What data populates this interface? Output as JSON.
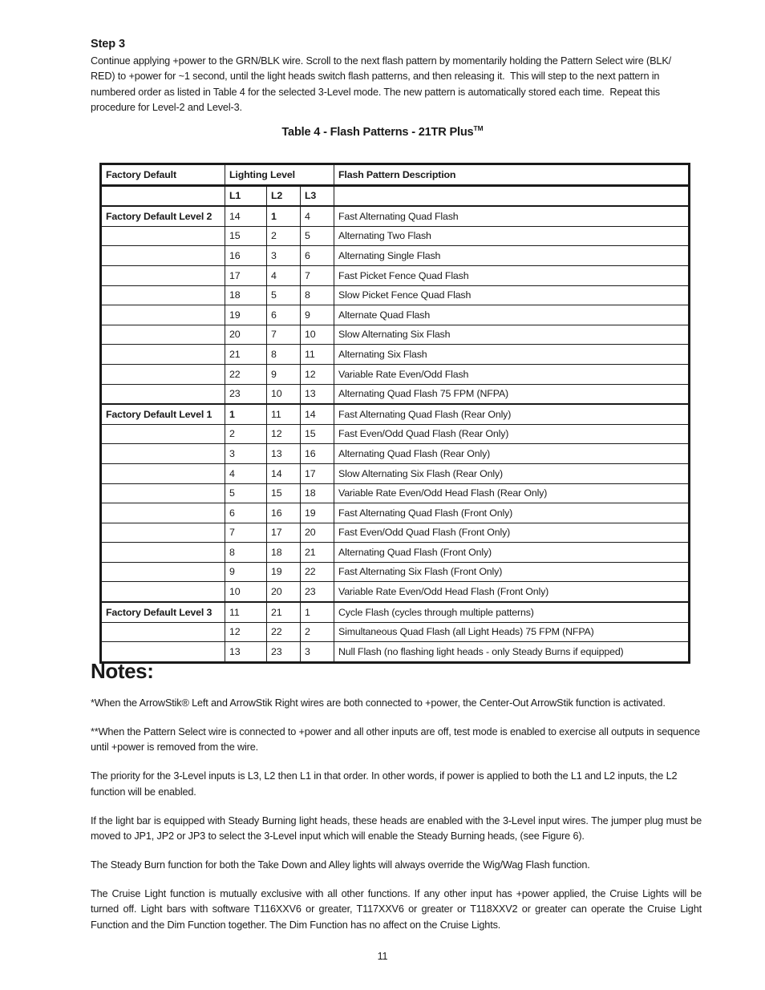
{
  "step": {
    "heading": "Step 3",
    "body": "Continue applying +power to the GRN/BLK wire. Scroll to the next flash pattern by momentarily holding the Pattern Select wire (BLK/\nRED) to +power for ~1 second, until the light heads switch flash patterns, and then releasing it.  This will step to the next pattern in\nnumbered order as listed in Table 4 for the selected 3-Level mode. The new pattern is automatically stored each time.  Repeat this\nprocedure for Level-2 and Level-3."
  },
  "table": {
    "title": "Table 4 - Flash Patterns - 21TR Plus",
    "title_superscript": "TM",
    "headers": {
      "factory_default": "Factory Default",
      "lighting_level": "Lighting Level",
      "flash_pattern_description": "Flash Pattern Description"
    },
    "sub_headers": {
      "l1": "L1",
      "l2": "L2",
      "l3": "L3"
    },
    "rows": [
      {
        "factory_default": "Factory Default Level 2",
        "l1": "14",
        "l2": "1",
        "l3": "4",
        "bold_level": "l2",
        "description": "Fast Alternating Quad Flash"
      },
      {
        "factory_default": "",
        "l1": "15",
        "l2": "2",
        "l3": "5",
        "bold_level": "",
        "description": "Alternating Two Flash"
      },
      {
        "factory_default": "",
        "l1": "16",
        "l2": "3",
        "l3": "6",
        "bold_level": "",
        "description": "Alternating Single Flash"
      },
      {
        "factory_default": "",
        "l1": "17",
        "l2": "4",
        "l3": "7",
        "bold_level": "",
        "description": "Fast Picket Fence Quad Flash"
      },
      {
        "factory_default": "",
        "l1": "18",
        "l2": "5",
        "l3": "8",
        "bold_level": "",
        "description": "Slow Picket Fence Quad Flash"
      },
      {
        "factory_default": "",
        "l1": "19",
        "l2": "6",
        "l3": "9",
        "bold_level": "",
        "description": "Alternate Quad Flash"
      },
      {
        "factory_default": "",
        "l1": "20",
        "l2": "7",
        "l3": "10",
        "bold_level": "",
        "description": "Slow Alternating Six Flash"
      },
      {
        "factory_default": "",
        "l1": "21",
        "l2": "8",
        "l3": "11",
        "bold_level": "",
        "description": "Alternating Six Flash"
      },
      {
        "factory_default": "",
        "l1": "22",
        "l2": "9",
        "l3": "12",
        "bold_level": "",
        "description": "Variable Rate Even/Odd Flash"
      },
      {
        "factory_default": "",
        "l1": "23",
        "l2": "10",
        "l3": "13",
        "bold_level": "",
        "description": "Alternating Quad Flash 75 FPM (NFPA)"
      },
      {
        "factory_default": "Factory Default Level 1",
        "l1": "1",
        "l2": "11",
        "l3": "14",
        "bold_level": "l1",
        "description": "Fast Alternating Quad Flash (Rear Only)"
      },
      {
        "factory_default": "",
        "l1": "2",
        "l2": "12",
        "l3": "15",
        "bold_level": "",
        "description": "Fast Even/Odd Quad Flash (Rear Only)"
      },
      {
        "factory_default": "",
        "l1": "3",
        "l2": "13",
        "l3": "16",
        "bold_level": "",
        "description": "Alternating Quad Flash (Rear Only)"
      },
      {
        "factory_default": "",
        "l1": "4",
        "l2": "14",
        "l3": "17",
        "bold_level": "",
        "description": "Slow Alternating Six Flash (Rear Only)"
      },
      {
        "factory_default": "",
        "l1": "5",
        "l2": "15",
        "l3": "18",
        "bold_level": "",
        "description": "Variable Rate Even/Odd Head Flash (Rear Only)"
      },
      {
        "factory_default": "",
        "l1": "6",
        "l2": "16",
        "l3": "19",
        "bold_level": "",
        "description": "Fast Alternating Quad Flash (Front Only)"
      },
      {
        "factory_default": "",
        "l1": "7",
        "l2": "17",
        "l3": "20",
        "bold_level": "",
        "description": "Fast Even/Odd Quad Flash (Front Only)"
      },
      {
        "factory_default": "",
        "l1": "8",
        "l2": "18",
        "l3": "21",
        "bold_level": "",
        "description": "Alternating Quad Flash (Front Only)"
      },
      {
        "factory_default": "",
        "l1": "9",
        "l2": "19",
        "l3": "22",
        "bold_level": "",
        "description": "Fast Alternating Six Flash (Front Only)"
      },
      {
        "factory_default": "",
        "l1": "10",
        "l2": "20",
        "l3": "23",
        "bold_level": "",
        "description": "Variable Rate Even/Odd Head Flash (Front Only)"
      },
      {
        "factory_default": "Factory Default Level 3",
        "l1": "11",
        "l2": "21",
        "l3": "1",
        "bold_level": "",
        "description": "Cycle Flash (cycles through multiple patterns)"
      },
      {
        "factory_default": "",
        "l1": "12",
        "l2": "22",
        "l3": "2",
        "bold_level": "",
        "description": "Simultaneous Quad Flash (all Light Heads) 75 FPM (NFPA)"
      },
      {
        "factory_default": "",
        "l1": "13",
        "l2": "23",
        "l3": "3",
        "bold_level": "",
        "description": "Null Flash (no flashing light heads - only Steady Burns if equipped)"
      }
    ]
  },
  "notes": {
    "heading": "Notes:",
    "paragraphs": [
      "*When the ArrowStik® Left and ArrowStik Right wires are both connected to +power, the Center-Out ArrowStik function is activated.",
      "**When the Pattern Select wire is connected to +power and all other inputs are off, test mode is enabled to exercise all outputs in sequence until +power is removed from the wire.",
      "The priority for the 3-Level inputs is L3, L2 then L1 in that order.  In other words, if power is applied to both the L1 and L2 inputs, the L2 function will be enabled.",
      "If the light bar is equipped with Steady Burning light heads, these heads are enabled with the 3-Level input wires.  The jumper plug must be moved to JP1, JP2 or JP3 to select the 3-Level input which will enable the Steady Burning heads, (see Figure 6).",
      "The Steady Burn function for both the Take Down and Alley lights will always override the Wig/Wag Flash function.",
      "The Cruise Light function is mutually exclusive with all other functions.  If any other input has +power applied, the Cruise Lights will be turned off. Light bars with software T116XXV6 or greater, T117XXV6 or greater or T118XXV2 or greater can operate the Cruise Light Function and the Dim Function together. The Dim Function has no affect on the Cruise Lights."
    ],
    "justified_from_index": 3
  },
  "page_number": "11"
}
